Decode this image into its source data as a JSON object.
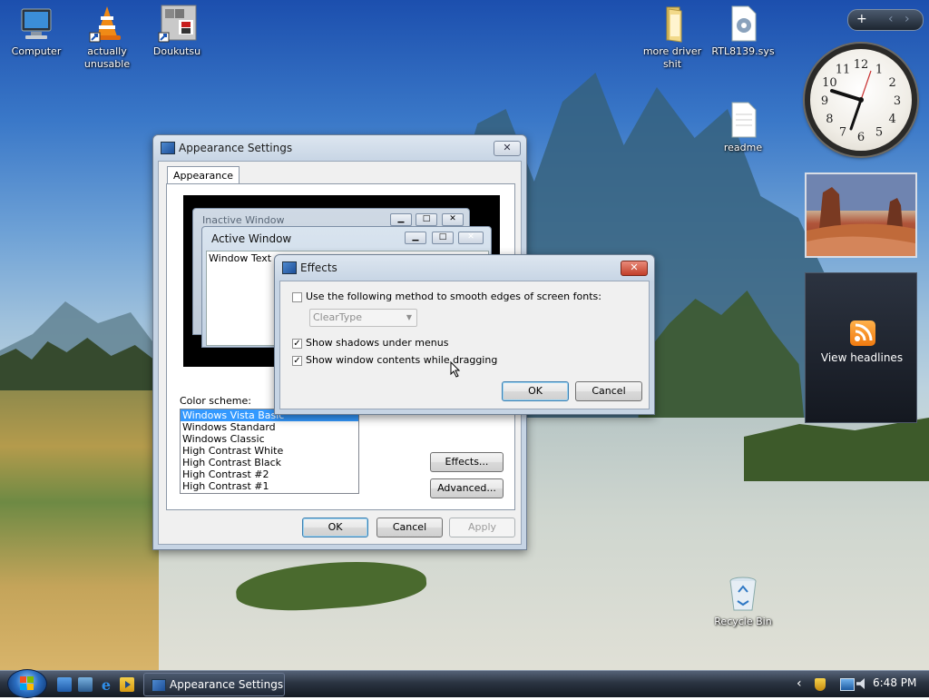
{
  "desktop": {
    "icons": [
      {
        "label": "Computer"
      },
      {
        "label": "actually unusable"
      },
      {
        "label": "Doukutsu"
      },
      {
        "label": "more driver shit"
      },
      {
        "label": "RTL8139.sys"
      },
      {
        "label": "readme"
      },
      {
        "label": "Recycle Bin"
      }
    ]
  },
  "sidebar": {
    "toolbar": {
      "add_label": "+",
      "prev_label": "‹",
      "next_label": "›"
    },
    "clock_numbers": [
      "12",
      "1",
      "2",
      "3",
      "4",
      "5",
      "6",
      "7",
      "8",
      "9",
      "10",
      "11"
    ],
    "feed_label": "View headlines"
  },
  "appearance": {
    "title": "Appearance Settings",
    "close_label": "✕",
    "tab_label": "Appearance",
    "preview": {
      "inactive_title": "Inactive Window",
      "active_title": "Active Window",
      "window_text": "Window Text"
    },
    "color_scheme_label": "Color scheme:",
    "schemes": [
      "Windows Vista Basic",
      "Windows Standard",
      "Windows Classic",
      "High Contrast White",
      "High Contrast Black",
      "High Contrast #2",
      "High Contrast #1"
    ],
    "selected_scheme": "Windows Vista Basic",
    "effects_button": "Effects...",
    "advanced_button": "Advanced...",
    "ok_button": "OK",
    "cancel_button": "Cancel",
    "apply_button": "Apply"
  },
  "effects": {
    "title": "Effects",
    "close_label": "✕",
    "smooth_label": "Use the following method to smooth edges of screen fonts:",
    "smooth_checked": false,
    "smooth_method": "ClearType",
    "shadows_label": "Show shadows under menus",
    "shadows_checked": true,
    "drag_label": "Show window contents while dragging",
    "drag_checked": true,
    "ok_button": "OK",
    "cancel_button": "Cancel"
  },
  "taskbar": {
    "task_label": "Appearance Settings",
    "time": "6:48 PM",
    "tray_arrow": "‹"
  },
  "colors": {
    "selection": "#3399ff",
    "close_red": "#c2402a",
    "taskbar": "#1e2633"
  }
}
